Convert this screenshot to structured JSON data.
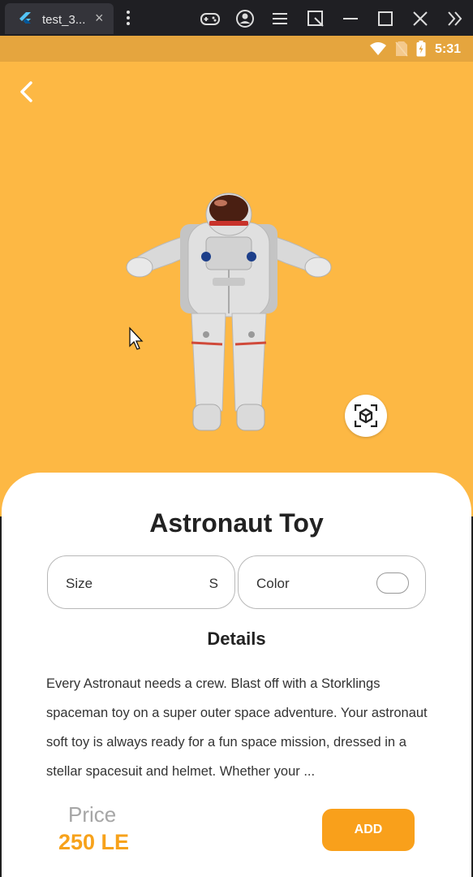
{
  "window": {
    "tab_title": "test_3...",
    "tab_close": "×"
  },
  "statusbar": {
    "time": "5:31"
  },
  "product": {
    "title": "Astronaut Toy",
    "size_label": "Size",
    "size_value": "S",
    "color_label": "Color",
    "details_heading": "Details",
    "description": "Every Astronaut needs a crew. Blast off with a Storklings spaceman toy on a super outer space adventure. Your astronaut soft toy is always ready for a fun space mission, dressed in a stellar spacesuit and helmet. Whether your ...",
    "price_label": "Price",
    "price_value": "250 LE",
    "add_label": "ADD"
  },
  "colors": {
    "accent": "#f9a01b",
    "hero_bg": "#fdb844"
  }
}
